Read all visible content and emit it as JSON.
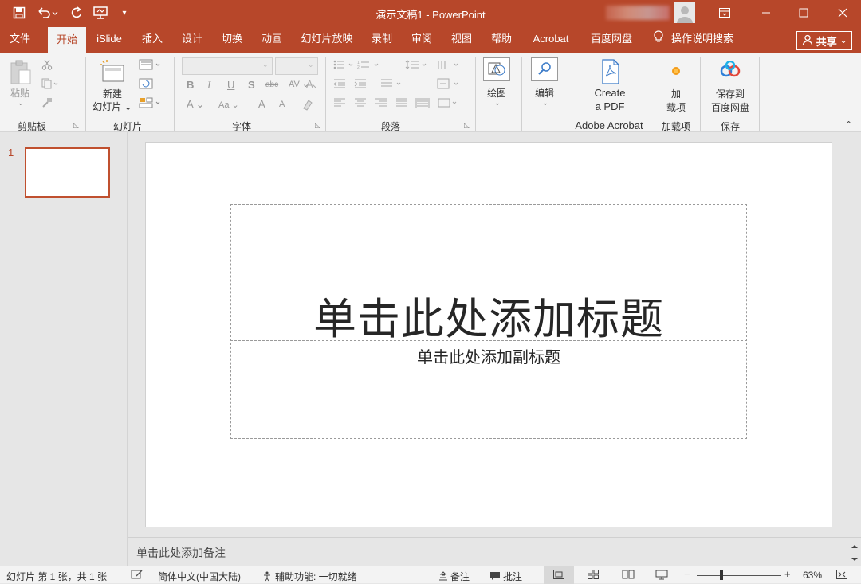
{
  "titlebar": {
    "doc_title": "演示文稿1  -  PowerPoint",
    "quick_access": [
      "save-icon",
      "undo-icon",
      "redo-icon",
      "present-icon",
      "customize-icon"
    ],
    "window_buttons": [
      "ribbon-display-icon",
      "minimize-icon",
      "maximize-icon",
      "close-icon"
    ]
  },
  "tabs": [
    "文件",
    "开始",
    "iSlide",
    "插入",
    "设计",
    "切换",
    "动画",
    "幻灯片放映",
    "录制",
    "审阅",
    "视图",
    "帮助",
    "Acrobat",
    "百度网盘"
  ],
  "active_tab": "开始",
  "tell_me": "操作说明搜索",
  "share_label": "共享",
  "ribbon": {
    "clipboard": {
      "paste": "粘贴",
      "group": "剪贴板"
    },
    "slides": {
      "new_slide_1": "新建",
      "new_slide_2": "幻灯片",
      "group": "幻灯片"
    },
    "font": {
      "group": "字体",
      "bold": "B",
      "italic": "I",
      "underline": "U",
      "shadow": "S",
      "strike": "abc",
      "spacing": "AV",
      "font_color": "A",
      "case": "Aa",
      "grow": "A",
      "shrink": "A"
    },
    "paragraph": {
      "group": "段落"
    },
    "drawing": {
      "label": "绘图"
    },
    "editing": {
      "label": "编辑"
    },
    "acrobat": {
      "label_1": "Create",
      "label_2": "a PDF",
      "group": "Adobe Acrobat"
    },
    "addins": {
      "label_1": "加",
      "label_2": "载项",
      "group": "加载项"
    },
    "baidu": {
      "label_1": "保存到",
      "label_2": "百度网盘",
      "group": "保存"
    }
  },
  "thumbnails": [
    {
      "number": "1"
    }
  ],
  "slide": {
    "title_placeholder": "单击此处添加标题",
    "subtitle_placeholder": "单击此处添加副标题"
  },
  "notes_placeholder": "单击此处添加备注",
  "status": {
    "slide_info": "幻灯片 第 1 张，共 1 张",
    "language": "简体中文(中国大陆)",
    "accessibility": "辅助功能: 一切就绪",
    "notes": "备注",
    "comments": "批注",
    "zoom": "63%"
  },
  "colors": {
    "accent": "#b7472a",
    "ribbon_bg": "#f3f3f3",
    "workspace": "#e6e6e6"
  }
}
